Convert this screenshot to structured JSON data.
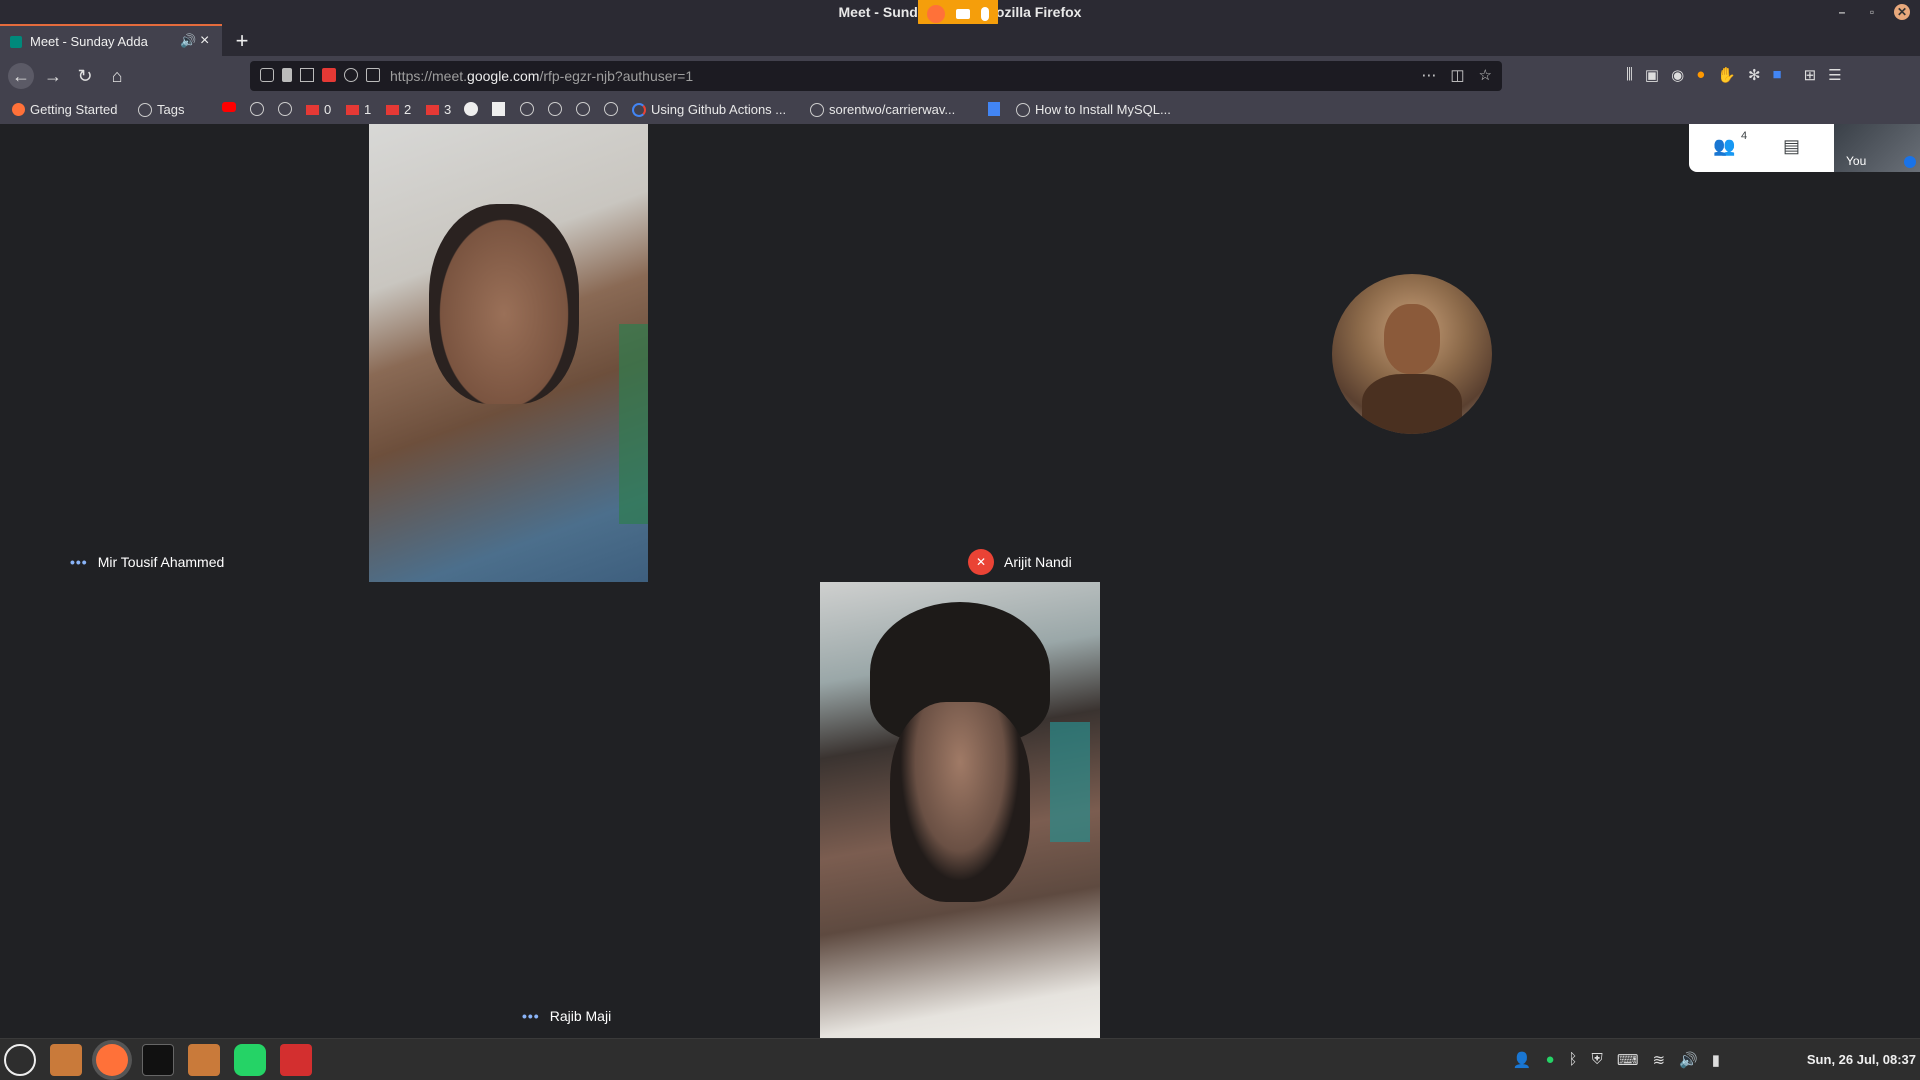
{
  "window": {
    "title": "Meet - Sunday Adda - Mozilla Firefox"
  },
  "tabs": [
    {
      "label": "Meet - Sunday Adda"
    }
  ],
  "navbar": {
    "url_prefix": "https://meet.",
    "url_domain": "google.com",
    "url_path": "/rfp-egzr-njb?authuser=1"
  },
  "bookmarks": [
    {
      "label": "Getting Started",
      "icon": "firefox-icon"
    },
    {
      "label": "Tags",
      "icon": "globe-icon"
    },
    {
      "label": "0",
      "icon": "gmail-icon"
    },
    {
      "label": "1",
      "icon": "gmail-icon"
    },
    {
      "label": "2",
      "icon": "gmail-icon"
    },
    {
      "label": "3",
      "icon": "gmail-icon"
    },
    {
      "label": "Using Github Actions ...",
      "icon": "google-icon"
    },
    {
      "label": "sorentwo/carrierwav...",
      "icon": "globe-icon"
    },
    {
      "label": "How to Install MySQL...",
      "icon": "globe-icon"
    }
  ],
  "meet": {
    "participant_count": "4",
    "self_label": "You",
    "participants": [
      {
        "name": "Mir Tousif Ahammed",
        "state": "speaking-dots"
      },
      {
        "name": "Arijit Nandi",
        "state": "muted"
      },
      {
        "name": "Rajib Maji",
        "state": "speaking-dots"
      }
    ]
  },
  "taskbar": {
    "clock": "Sun, 26 Jul, 08:37"
  },
  "colors": {
    "meet_bg": "#202124",
    "muted_red": "#ea4335",
    "firefox_chrome": "#42414d"
  }
}
